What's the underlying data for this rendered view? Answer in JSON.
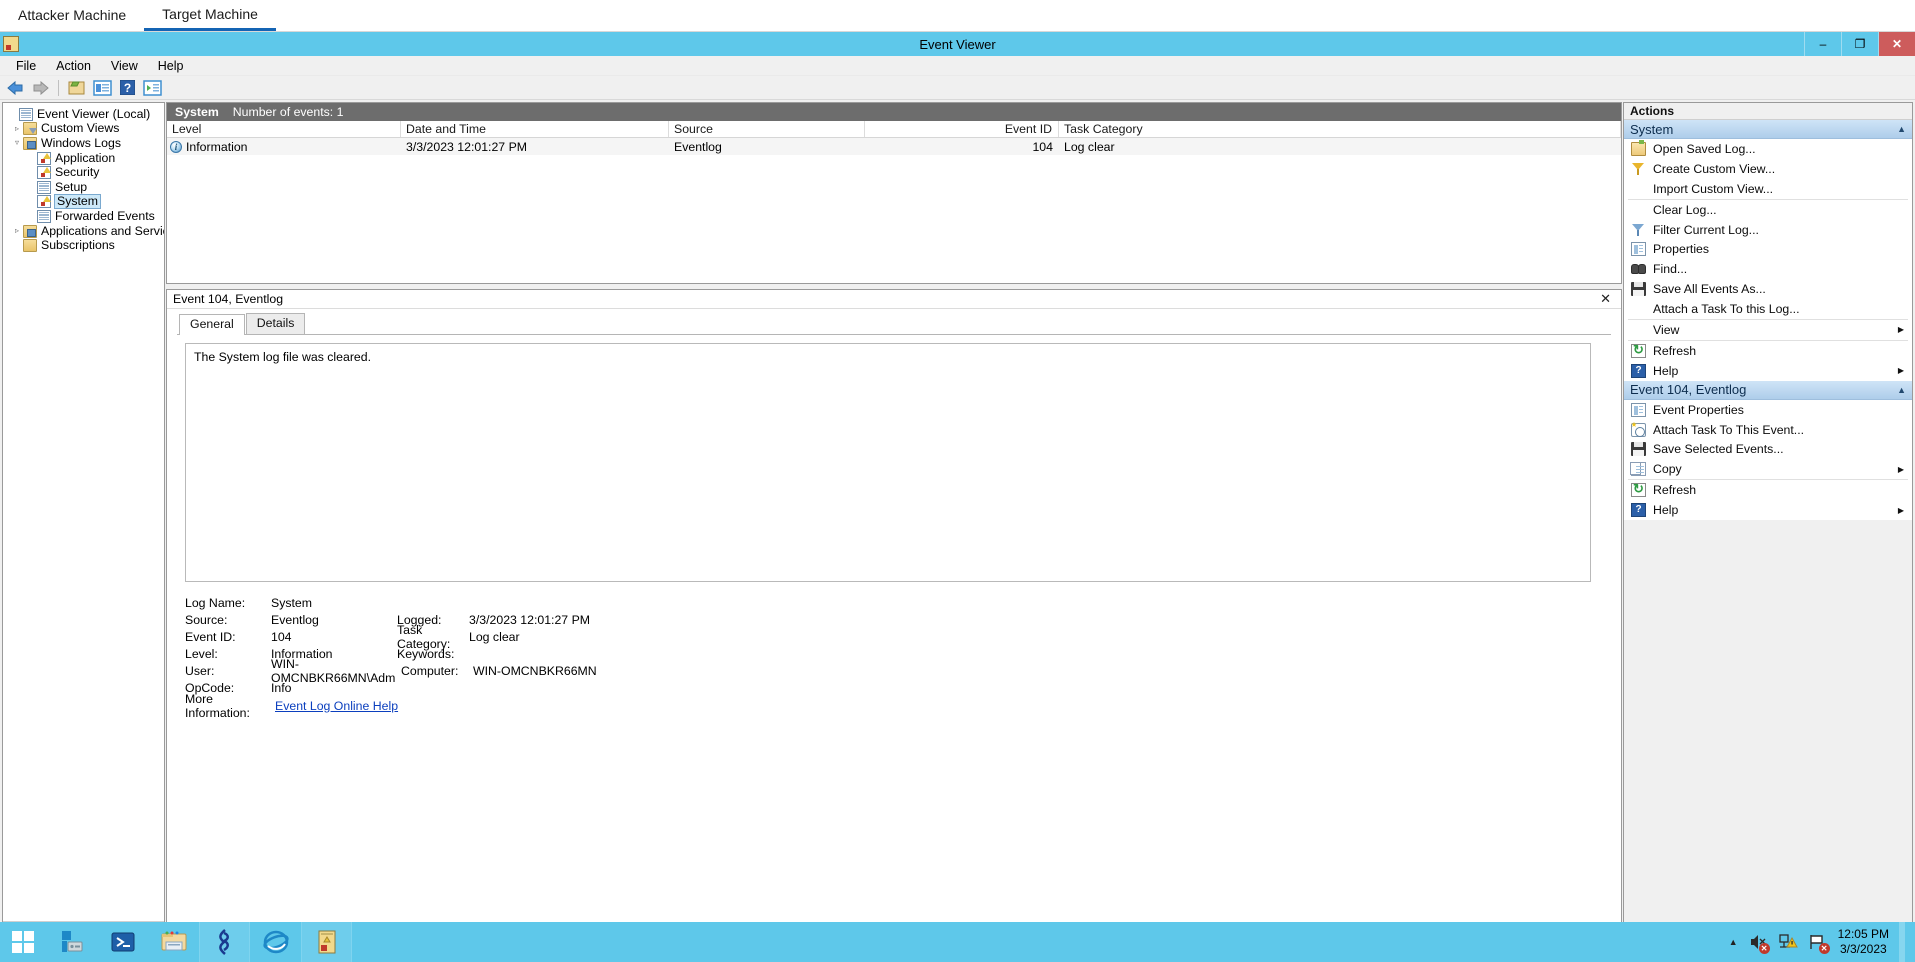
{
  "tabs": [
    {
      "label": "Attacker Machine",
      "active": false
    },
    {
      "label": "Target Machine",
      "active": true
    }
  ],
  "window": {
    "title": "Event Viewer",
    "icon": "event-viewer-icon",
    "minimize": "–",
    "maximize": "❐",
    "close": "✕"
  },
  "menu": [
    "File",
    "Action",
    "View",
    "Help"
  ],
  "toolbar": [
    {
      "name": "back-button",
      "glyph": "←"
    },
    {
      "name": "forward-button",
      "glyph": "→"
    },
    {
      "name": "show-hide-console-tree-button",
      "glyph": ""
    },
    {
      "name": "properties-button",
      "glyph": ""
    },
    {
      "name": "help-button",
      "glyph": "?"
    },
    {
      "name": "show-hide-action-pane-button",
      "glyph": ""
    }
  ],
  "tree": [
    {
      "label": "Event Viewer (Local)",
      "indent": 0,
      "expander": "",
      "icon": "event-viewer-root-icon",
      "selected": false
    },
    {
      "label": "Custom Views",
      "indent": 1,
      "expander": "▹",
      "icon": "custom-views-folder-icon",
      "selected": false
    },
    {
      "label": "Windows Logs",
      "indent": 1,
      "expander": "▿",
      "icon": "windows-logs-folder-icon",
      "selected": false
    },
    {
      "label": "Application",
      "indent": 2,
      "expander": "",
      "icon": "log-warning-icon",
      "selected": false
    },
    {
      "label": "Security",
      "indent": 2,
      "expander": "",
      "icon": "log-warning-icon",
      "selected": false
    },
    {
      "label": "Setup",
      "indent": 2,
      "expander": "",
      "icon": "log-icon",
      "selected": false
    },
    {
      "label": "System",
      "indent": 2,
      "expander": "",
      "icon": "log-warning-icon",
      "selected": true
    },
    {
      "label": "Forwarded Events",
      "indent": 2,
      "expander": "",
      "icon": "log-icon",
      "selected": false
    },
    {
      "label": "Applications and Services Lo",
      "indent": 1,
      "expander": "▹",
      "icon": "app-services-folder-icon",
      "selected": false
    },
    {
      "label": "Subscriptions",
      "indent": 1,
      "expander": "",
      "icon": "subscriptions-icon",
      "selected": false
    }
  ],
  "tree_scroll": {
    "left_arrow": "◂",
    "right_arrow": "▸",
    "thumb_grip": "|||"
  },
  "list": {
    "log_name": "System",
    "count_label": "Number of events: 1",
    "columns": [
      "Level",
      "Date and Time",
      "Source",
      "Event ID",
      "Task Category"
    ],
    "rows": [
      {
        "level": "Information",
        "level_icon": "information-icon",
        "date_time": "3/3/2023 12:01:27 PM",
        "source": "Eventlog",
        "event_id": "104",
        "task_category": "Log clear"
      }
    ]
  },
  "detail": {
    "title": "Event 104, Eventlog",
    "close": "✕",
    "tabs": [
      {
        "label": "General",
        "active": true
      },
      {
        "label": "Details",
        "active": false
      }
    ],
    "message": "The System log file was cleared.",
    "fields": [
      {
        "l1": "Log Name:",
        "v1": "System",
        "l2": "",
        "v2": ""
      },
      {
        "l1": "Source:",
        "v1": "Eventlog",
        "l2": "Logged:",
        "v2": "3/3/2023 12:01:27 PM"
      },
      {
        "l1": "Event ID:",
        "v1": "104",
        "l2": "Task Category:",
        "v2": "Log clear"
      },
      {
        "l1": "Level:",
        "v1": "Information",
        "l2": "Keywords:",
        "v2": ""
      },
      {
        "l1": "User:",
        "v1": "WIN-OMCNBKR66MN\\Adm",
        "l2": "Computer:",
        "v2": "WIN-OMCNBKR66MN"
      },
      {
        "l1": "OpCode:",
        "v1": "Info",
        "l2": "",
        "v2": ""
      }
    ],
    "more_info_label": "More Information:",
    "more_info_link": "Event Log Online Help"
  },
  "actions": {
    "header": "Actions",
    "groups": [
      {
        "title": "System",
        "caret": "▲",
        "items": [
          {
            "label": "Open Saved Log...",
            "icon": "open-folder-icon",
            "icon_class": "ic-openfolder",
            "arrow": "",
            "sep_after": false
          },
          {
            "label": "Create Custom View...",
            "icon": "filter-yellow-icon",
            "icon_class": "ic-filter-y",
            "arrow": "",
            "sep_after": false
          },
          {
            "label": "Import Custom View...",
            "icon": "",
            "icon_class": "",
            "arrow": "",
            "sep_after": true
          },
          {
            "label": "Clear Log...",
            "icon": "",
            "icon_class": "",
            "arrow": "",
            "sep_after": false
          },
          {
            "label": "Filter Current Log...",
            "icon": "filter-blue-icon",
            "icon_class": "ic-filter-b",
            "arrow": "",
            "sep_after": false
          },
          {
            "label": "Properties",
            "icon": "properties-icon",
            "icon_class": "ic-props",
            "arrow": "",
            "sep_after": false
          },
          {
            "label": "Find...",
            "icon": "binoculars-icon",
            "icon_class": "ic-find",
            "arrow": "",
            "sep_after": false
          },
          {
            "label": "Save All Events As...",
            "icon": "save-icon",
            "icon_class": "ic-save",
            "arrow": "",
            "sep_after": false
          },
          {
            "label": "Attach a Task To this Log...",
            "icon": "",
            "icon_class": "",
            "arrow": "",
            "sep_after": true
          },
          {
            "label": "View",
            "icon": "",
            "icon_class": "",
            "arrow": "▶",
            "sep_after": true
          },
          {
            "label": "Refresh",
            "icon": "refresh-icon",
            "icon_class": "ic-refresh",
            "arrow": "",
            "sep_after": false
          },
          {
            "label": "Help",
            "icon": "help-icon",
            "icon_class": "ic-help",
            "arrow": "▶",
            "sep_after": false
          }
        ]
      },
      {
        "title": "Event 104, Eventlog",
        "caret": "▲",
        "items": [
          {
            "label": "Event Properties",
            "icon": "properties-icon",
            "icon_class": "ic-props",
            "arrow": "",
            "sep_after": false
          },
          {
            "label": "Attach Task To This Event...",
            "icon": "attach-task-icon",
            "icon_class": "ic-clock",
            "arrow": "",
            "sep_after": false
          },
          {
            "label": "Save Selected Events...",
            "icon": "save-icon",
            "icon_class": "ic-save",
            "arrow": "",
            "sep_after": false
          },
          {
            "label": "Copy",
            "icon": "copy-icon",
            "icon_class": "ic-copy",
            "arrow": "▶",
            "sep_after": true
          },
          {
            "label": "Refresh",
            "icon": "refresh-icon",
            "icon_class": "ic-refresh",
            "arrow": "",
            "sep_after": false
          },
          {
            "label": "Help",
            "icon": "help-icon",
            "icon_class": "ic-help",
            "arrow": "▶",
            "sep_after": false
          }
        ]
      }
    ]
  },
  "taskbar": {
    "start": "start-button",
    "apps": [
      {
        "name": "server-manager-icon",
        "boxed": false
      },
      {
        "name": "powershell-icon",
        "boxed": false
      },
      {
        "name": "file-explorer-icon",
        "boxed": false
      },
      {
        "name": "bitvise-icon",
        "boxed": true
      },
      {
        "name": "internet-explorer-icon",
        "boxed": false
      },
      {
        "name": "event-viewer-taskbar-icon",
        "boxed": true
      }
    ],
    "tray": {
      "show_hidden": "▲",
      "icons": [
        "volume-muted-icon",
        "network-warning-icon",
        "action-center-flag-icon"
      ],
      "badge": "✕"
    },
    "clock_time": "12:05 PM",
    "clock_date": "3/3/2023"
  },
  "colors": {
    "accent_blue": "#1464b4",
    "titlebar": "#5ec8ea",
    "close_red": "#cd5c5c",
    "list_header": "#6d6d6d",
    "action_group": "#aecdea",
    "link": "#0b3fbe"
  }
}
